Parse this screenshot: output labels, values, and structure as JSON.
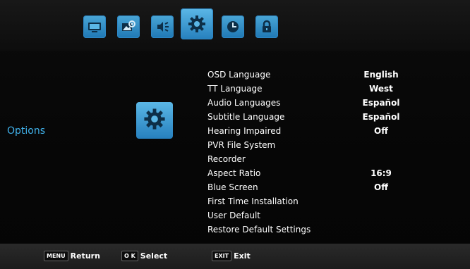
{
  "tabs": [
    {
      "icon": "monitor-icon"
    },
    {
      "icon": "picture-icon"
    },
    {
      "icon": "speaker-icon"
    },
    {
      "icon": "gear-icon",
      "active": true
    },
    {
      "icon": "clock-icon"
    },
    {
      "icon": "lock-icon"
    }
  ],
  "section_title": "Options",
  "menu": [
    {
      "label": "OSD Language",
      "value": "English"
    },
    {
      "label": "TT Language",
      "value": "West"
    },
    {
      "label": "Audio Languages",
      "value": "Español"
    },
    {
      "label": "Subtitle Language",
      "value": "Español"
    },
    {
      "label": "Hearing Impaired",
      "value": "Off"
    },
    {
      "label": "PVR File System",
      "value": ""
    },
    {
      "label": "Recorder",
      "value": ""
    },
    {
      "label": "Aspect Ratio",
      "value": "16:9"
    },
    {
      "label": "Blue Screen",
      "value": "Off"
    },
    {
      "label": "First Time Installation",
      "value": ""
    },
    {
      "label": "User Default",
      "value": ""
    },
    {
      "label": "Restore Default Settings",
      "value": ""
    }
  ],
  "footer": {
    "menu_key": "MENU",
    "menu_label": "Return",
    "ok_key": "O K",
    "ok_label": "Select",
    "exit_key": "EXIT",
    "exit_label": "Exit"
  },
  "colors": {
    "accent": "#40b1ea",
    "tab_blue": "#2680bd"
  }
}
